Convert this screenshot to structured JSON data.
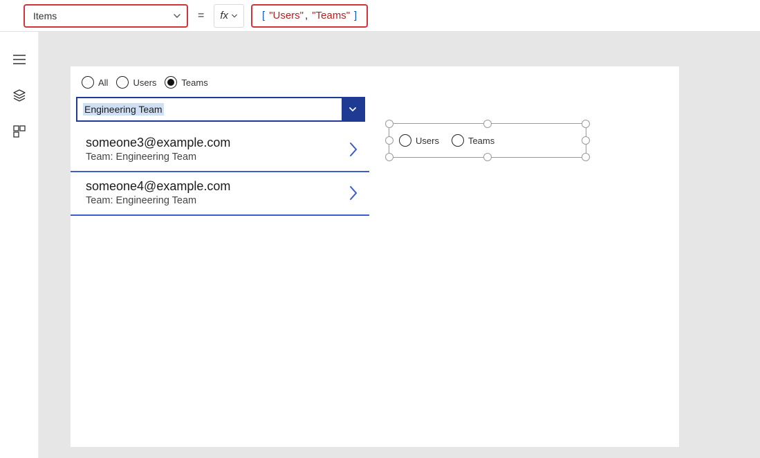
{
  "formula_bar": {
    "property": "Items",
    "fx_label": "fx",
    "formula_tokens": {
      "open": "[",
      "s1": "\"Users\"",
      "comma": ",",
      "s2": "\"Teams\"",
      "close": "]"
    }
  },
  "radio1": {
    "opt_all": "All",
    "opt_users": "Users",
    "opt_teams": "Teams"
  },
  "dropdown": {
    "selected": "Engineering Team"
  },
  "gallery": [
    {
      "title": "someone3@example.com",
      "sub": "Team: Engineering Team"
    },
    {
      "title": "someone4@example.com",
      "sub": "Team: Engineering Team"
    }
  ],
  "radio2": {
    "opt_users": "Users",
    "opt_teams": "Teams"
  }
}
